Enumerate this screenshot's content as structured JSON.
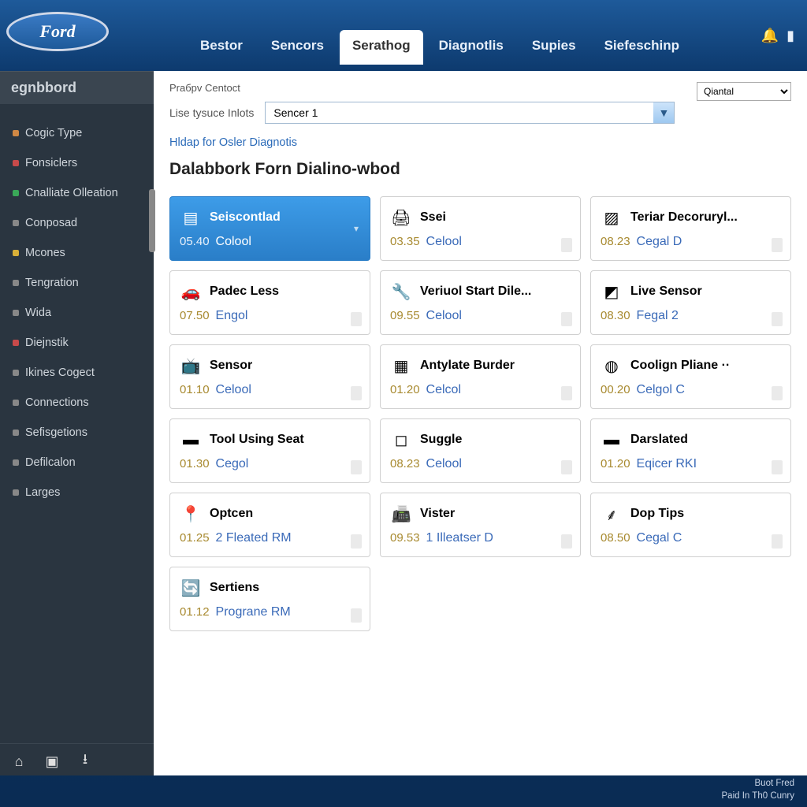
{
  "brand": {
    "name": "Ford"
  },
  "nav": {
    "tabs": [
      "Bestor",
      "Sencors",
      "Serathog",
      "Diagnotlis",
      "Supies",
      "Siefeschinp"
    ],
    "active_index": 2
  },
  "sidebar": {
    "title": "egnbbord",
    "items": [
      {
        "label": "Cogic Type",
        "color": "#d08844"
      },
      {
        "label": "Fonsiclers",
        "color": "#c84a4a"
      },
      {
        "label": "Cnalliate Olleation",
        "color": "#3aa858"
      },
      {
        "label": "Conposad",
        "color": "#888888"
      },
      {
        "label": "Mcones",
        "color": "#d8b038"
      },
      {
        "label": "Tengration",
        "color": "#888888"
      },
      {
        "label": "Wida",
        "color": "#888888"
      },
      {
        "label": "Diejnstik",
        "color": "#c84a4a"
      },
      {
        "label": "Ikines Cogect",
        "color": "#888888"
      },
      {
        "label": "Connections",
        "color": "#888888"
      },
      {
        "label": "Sefisgetions",
        "color": "#888888"
      },
      {
        "label": "Defilcalon",
        "color": "#888888"
      },
      {
        "label": "Larges",
        "color": "#888888"
      }
    ]
  },
  "toolbar": {
    "context_label": "Praбpv Centoct",
    "selector_label": "Lise tysuce Inlots",
    "dropdown_value": "Sencer 1",
    "quick_value": "Qiantal",
    "help_link": "Hldap for Osler Diagnotis",
    "section_title": "Dalabbork Forn Dialino-wbod"
  },
  "cards": [
    {
      "title": "Seiscontlad",
      "time": "05.40",
      "status": "Colool",
      "icon": "cassette-icon",
      "glyph": "▤",
      "selected": true
    },
    {
      "title": "Ssei",
      "time": "03.35",
      "status": "Celool",
      "icon": "printer-icon",
      "glyph": "🖨",
      "selected": false
    },
    {
      "title": "Teriar Decoruryl...",
      "time": "08.23",
      "status": "Cegal D",
      "icon": "gauge-icon",
      "glyph": "▨",
      "selected": false
    },
    {
      "title": "Padec Less",
      "time": "07.50",
      "status": "Engol",
      "icon": "car-icon",
      "glyph": "🚗",
      "selected": false
    },
    {
      "title": "Veriuol Start Dile...",
      "time": "09.55",
      "status": "Celool",
      "icon": "wrench-icon",
      "glyph": "🔧",
      "selected": false
    },
    {
      "title": "Live Sensor",
      "time": "08.30",
      "status": "Fegal 2",
      "icon": "bookmark-icon",
      "glyph": "◩",
      "selected": false
    },
    {
      "title": "Sensor",
      "time": "01.10",
      "status": "Celool",
      "icon": "screen-icon",
      "glyph": "📺",
      "selected": false
    },
    {
      "title": "Antylate Burder",
      "time": "01.20",
      "status": "Celcol",
      "icon": "window-icon",
      "glyph": "▦",
      "selected": false
    },
    {
      "title": "Coolign Pliane ··",
      "time": "00.20",
      "status": "Celgol C",
      "icon": "disc-icon",
      "glyph": "◍",
      "selected": false
    },
    {
      "title": "Tool Using Seat",
      "time": "01.30",
      "status": "Cegol",
      "icon": "bar-icon",
      "glyph": "▬",
      "selected": false
    },
    {
      "title": "Suggle",
      "time": "08.23",
      "status": "Celool",
      "icon": "square-icon",
      "glyph": "◻",
      "selected": false
    },
    {
      "title": "Darslated",
      "time": "01.20",
      "status": "Eqicer RKI",
      "icon": "bar-icon",
      "glyph": "▬",
      "selected": false
    },
    {
      "title": "Optcen",
      "time": "01.25",
      "status": "2 Fleated RM",
      "icon": "pin-icon",
      "glyph": "📍",
      "selected": false
    },
    {
      "title": "Vister",
      "time": "09.53",
      "status": "1 Illeatser D",
      "icon": "device-icon",
      "glyph": "📠",
      "selected": false
    },
    {
      "title": "Dop Tips",
      "time": "08.50",
      "status": "Cegal C",
      "icon": "meter-icon",
      "glyph": "⸙",
      "selected": false
    },
    {
      "title": "Sertiens",
      "time": "01.12",
      "status": "Prograne RM",
      "icon": "gear-icon",
      "glyph": "🔄",
      "selected": false
    }
  ],
  "footer": {
    "line1": "Buot Fred",
    "line2": "Paid In Th0 Cunry"
  }
}
